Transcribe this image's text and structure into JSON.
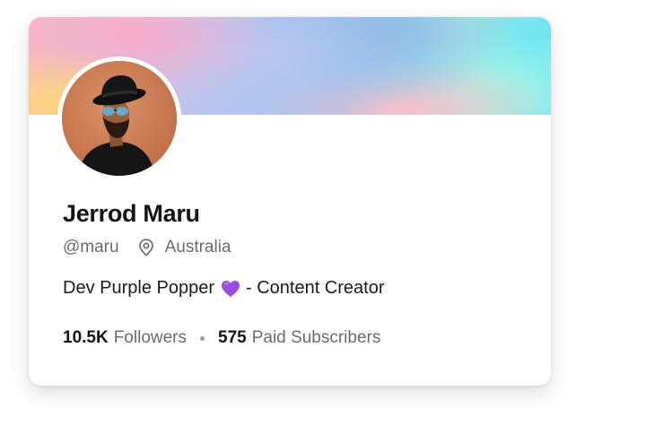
{
  "profile": {
    "name": "Jerrod Maru",
    "handle": "@maru",
    "location": "Australia",
    "bio_before": "Dev Purple Popper",
    "bio_emoji": "purple-heart",
    "bio_after": "- Content Creator",
    "followers_count": "10.5K",
    "followers_label": "Followers",
    "subscribers_count": "575",
    "subscribers_label": "Paid Subscribers"
  },
  "icons": {
    "location": "map-pin-icon",
    "heart": "purple-heart-icon",
    "separator": "dot-separator"
  },
  "colors": {
    "heart": "#9b4ddb",
    "text_primary": "#141414",
    "text_secondary": "#6b6b6b"
  }
}
